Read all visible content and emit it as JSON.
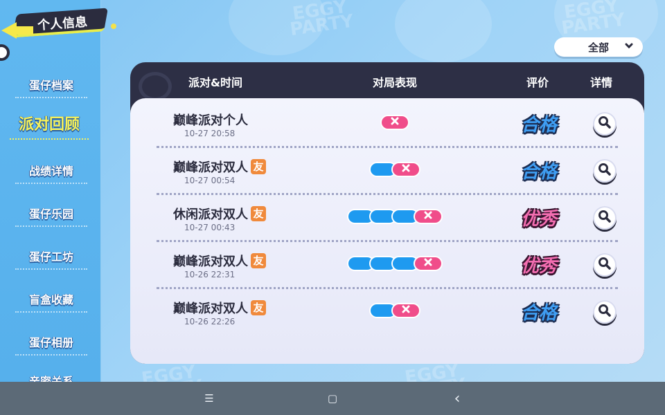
{
  "window": {
    "title": "个人信息"
  },
  "sidebar": {
    "items": [
      {
        "label": "蛋仔档案"
      },
      {
        "label": "派对回顾"
      },
      {
        "label": "战绩详情"
      },
      {
        "label": "蛋仔乐园"
      },
      {
        "label": "蛋仔工坊"
      },
      {
        "label": "盲盒收藏"
      },
      {
        "label": "蛋仔相册"
      },
      {
        "label": "亲密关系"
      }
    ],
    "active_index": 1
  },
  "filter": {
    "selected": "全部"
  },
  "table": {
    "headers": [
      "派对&时间",
      "对局表现",
      "评价",
      "详情"
    ],
    "rows": [
      {
        "mode": "巅峰派对个人",
        "friend": "",
        "time": "10-27 20:58",
        "wins": 0,
        "losses": 1,
        "rating": "合格",
        "rating_color": "#3f9ef3"
      },
      {
        "mode": "巅峰派对双人",
        "friend": "友",
        "time": "10-27 00:54",
        "wins": 1,
        "losses": 1,
        "rating": "合格",
        "rating_color": "#3f9ef3"
      },
      {
        "mode": "休闲派对双人",
        "friend": "友",
        "time": "10-27 00:43",
        "wins": 3,
        "losses": 1,
        "rating": "优秀",
        "rating_color": "#f46eb1"
      },
      {
        "mode": "巅峰派对双人",
        "friend": "友",
        "time": "10-26 22:31",
        "wins": 3,
        "losses": 1,
        "rating": "优秀",
        "rating_color": "#f46eb1"
      },
      {
        "mode": "巅峰派对双人",
        "friend": "友",
        "time": "10-26 22:26",
        "wins": 1,
        "losses": 1,
        "rating": "合格",
        "rating_color": "#3f9ef3"
      }
    ]
  },
  "background": {
    "watermark": "EGGY PARTY"
  },
  "icons": {
    "back": "back-arrow-icon",
    "filter": "chevron-down-icon",
    "detail": "magnifier-icon",
    "loss": "cross-icon",
    "menu": "menu-icon",
    "home": "home-icon",
    "back_sys": "back-icon"
  },
  "system_bar": {
    "menu_glyph": "☰",
    "home_glyph": "▢",
    "back_glyph": "‹"
  }
}
